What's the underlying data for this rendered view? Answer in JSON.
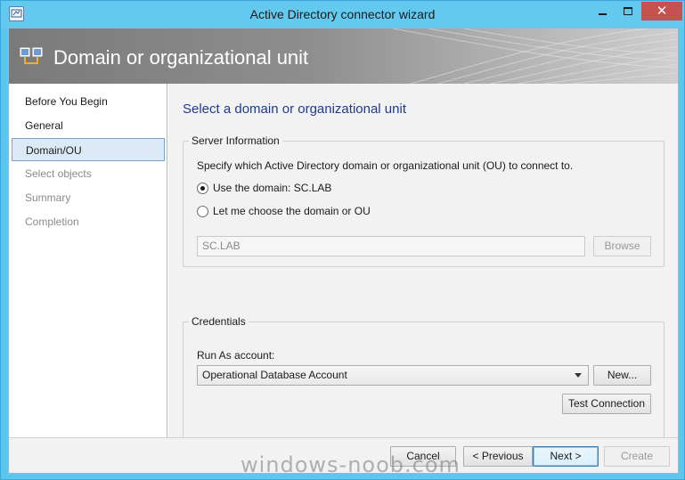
{
  "window": {
    "title": "Active Directory connector wizard",
    "close_glyph": "✕"
  },
  "banner": {
    "title": "Domain or organizational unit",
    "icon": "connector-icon"
  },
  "nav": {
    "items": [
      {
        "label": "Before You Begin",
        "state": "normal"
      },
      {
        "label": "General",
        "state": "normal"
      },
      {
        "label": "Domain/OU",
        "state": "active"
      },
      {
        "label": "Select objects",
        "state": "dim"
      },
      {
        "label": "Summary",
        "state": "dim"
      },
      {
        "label": "Completion",
        "state": "dim"
      }
    ]
  },
  "content": {
    "heading": "Select a domain or organizational unit",
    "server_info": {
      "legend": "Server Information",
      "description": "Specify which Active Directory domain or organizational unit (OU) to connect to.",
      "radio_use_domain": "Use the domain: SC.LAB",
      "radio_choose": "Let me choose the domain or OU",
      "domain_value": "SC.LAB",
      "browse_label": "Browse"
    },
    "credentials": {
      "legend": "Credentials",
      "run_as_label": "Run As account:",
      "run_as_value": "Operational Database Account",
      "new_label": "New...",
      "test_label": "Test Connection"
    }
  },
  "footer": {
    "cancel": "Cancel",
    "previous": "< Previous",
    "next": "Next >",
    "create": "Create"
  },
  "watermark": "windows-noob.com",
  "colors": {
    "frame": "#5cc6ee",
    "close_button": "#c75050",
    "heading": "#1f3a93",
    "nav_active": "#dceaf7"
  }
}
